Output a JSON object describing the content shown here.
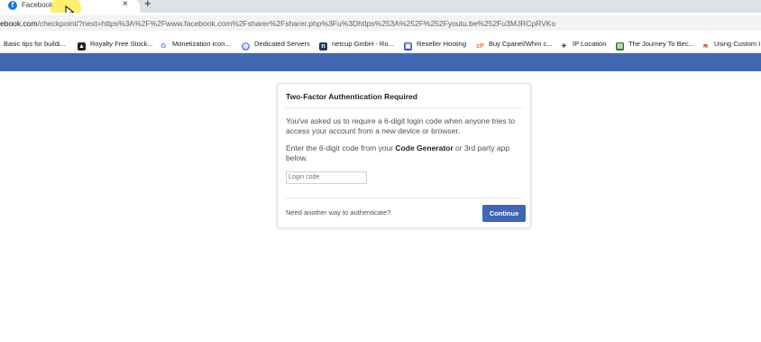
{
  "browser": {
    "tab": {
      "title": "Facebook",
      "close": "×",
      "favicon": "facebook-icon"
    },
    "new_tab": "+",
    "url": {
      "host_part": "ebook.com",
      "rest": "/checkpoint/?next=https%3A%2F%2Fwww.facebook.com%2Fsharer%2Fsharer.php%3Fu%3Dhttps%253A%252F%252Fyoutu.be%252Fu3MJRCpRVKo"
    },
    "bookmarks": [
      {
        "label": "Basic tips for buildi...",
        "icon": "bookmark-icon"
      },
      {
        "label": "Royalty Free Stock...",
        "icon": "triangle-logo-icon"
      },
      {
        "label": "Monetization icon...",
        "icon": "google-icon"
      },
      {
        "label": "Dedicated Servers",
        "icon": "globe-icon"
      },
      {
        "label": "netcup GmbH - Ro...",
        "icon": "netcup-icon"
      },
      {
        "label": "Reseller Hosting",
        "icon": "hosting-icon"
      },
      {
        "label": "Buy Cpanel/Whm c...",
        "icon": "cpanel-icon"
      },
      {
        "label": "IP Location",
        "icon": "ip-location-icon"
      },
      {
        "label": "The Journey To Bec...",
        "icon": "journey-icon"
      },
      {
        "label": "Using Custom I",
        "icon": "custom-icon"
      }
    ]
  },
  "dialog": {
    "title": "Two-Factor Authentication Required",
    "paragraph1": "You've asked us to require a 6-digit login code when anyone tries to access your account from a new device or browser.",
    "paragraph2_pre": "Enter the 6-digit code from your ",
    "paragraph2_bold": "Code Generator",
    "paragraph2_post": " or 3rd party app below.",
    "input_placeholder": "Login code",
    "footer_link": "Need another way to authenticate?",
    "continue_label": "Continue"
  },
  "colors": {
    "facebook_blue": "#4267b2",
    "button_blue": "#4267b2"
  }
}
